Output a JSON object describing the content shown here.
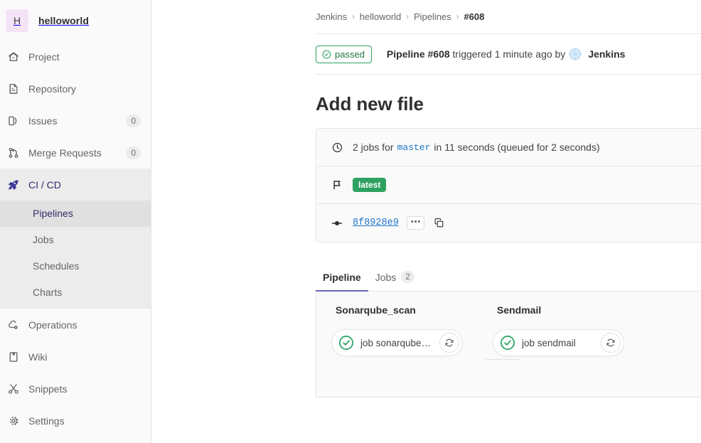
{
  "sidebar": {
    "project": {
      "initial": "H",
      "name": "helloworld",
      "avatar_color": "#f4e3f6"
    },
    "items": [
      {
        "label": "Project",
        "icon": "home-icon",
        "count": null
      },
      {
        "label": "Repository",
        "icon": "document-icon",
        "count": null
      },
      {
        "label": "Issues",
        "icon": "issues-icon",
        "count": "0"
      },
      {
        "label": "Merge Requests",
        "icon": "merge-request-icon",
        "count": "0"
      },
      {
        "label": "CI / CD",
        "icon": "rocket-icon",
        "count": null
      },
      {
        "label": "Operations",
        "icon": "operations-icon",
        "count": null
      },
      {
        "label": "Wiki",
        "icon": "book-icon",
        "count": null
      },
      {
        "label": "Snippets",
        "icon": "scissors-icon",
        "count": null
      },
      {
        "label": "Settings",
        "icon": "gear-icon",
        "count": null
      }
    ],
    "subitems": [
      {
        "label": "Pipelines",
        "active": true
      },
      {
        "label": "Jobs",
        "active": false
      },
      {
        "label": "Schedules",
        "active": false
      },
      {
        "label": "Charts",
        "active": false
      }
    ]
  },
  "breadcrumb": {
    "items": [
      "Jenkins",
      "helloworld",
      "Pipelines"
    ],
    "separator": "›",
    "current": "#608"
  },
  "status": {
    "badge_label": "passed",
    "badge_color": "#2da160",
    "prefix": "Pipeline",
    "pipeline_id": "#608",
    "triggered_text": "triggered 1 minute ago by",
    "user": "Jenkins"
  },
  "page": {
    "title": "Add new file"
  },
  "info_card": {
    "jobs_row": {
      "icon": "clock-icon",
      "prefix": "2 jobs for",
      "ref": "master",
      "suffix": "in 11 seconds (queued for 2 seconds)"
    },
    "tag_row": {
      "icon": "flag-icon",
      "label": "latest",
      "color": "#2da160"
    },
    "commit_row": {
      "icon": "commit-icon",
      "sha": "8f8928e9",
      "ellipsis_label": "•••",
      "copy_icon": "copy-icon"
    }
  },
  "tabs": [
    {
      "label": "Pipeline",
      "count": null,
      "active": true
    },
    {
      "label": "Jobs",
      "count": "2",
      "active": false
    }
  ],
  "pipeline_graph": {
    "stages": [
      {
        "name": "Sonarqube_scan",
        "jobs": [
          {
            "name": "job sonarqube_s...",
            "status": "success",
            "action": "retry-icon"
          }
        ]
      },
      {
        "name": "Sendmail",
        "jobs": [
          {
            "name": "job sendmail",
            "status": "success",
            "action": "retry-icon"
          }
        ]
      }
    ]
  }
}
